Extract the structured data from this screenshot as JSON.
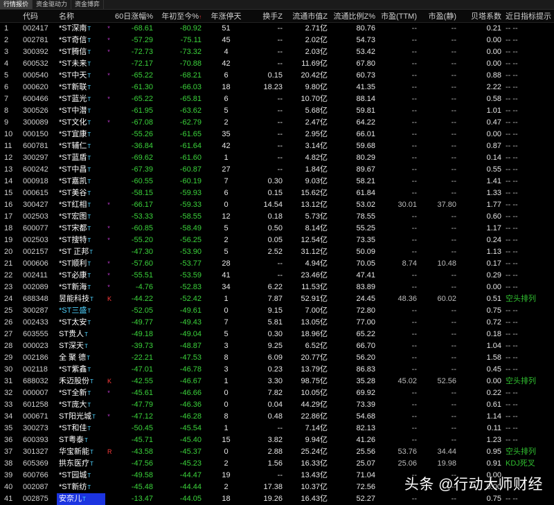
{
  "tabs": [
    "行情报价",
    "资金驱动力",
    "资金博弈"
  ],
  "headers": [
    "",
    "代码",
    "名称",
    "",
    "60日涨幅%",
    "年初至今%",
    "年涨停天",
    "换手Z",
    "流通市值Z",
    "流通比例Z%",
    "市盈(TTM)",
    "市盈(静)",
    "贝塔系数",
    "近日指标提示"
  ],
  "sort_arrow": "↑",
  "colors": {
    "negative": "#3bd43b",
    "cyan_name": "#4fd3ff",
    "selected_bg": "#1c34e0",
    "signal": "#30c030"
  },
  "rows": [
    {
      "i": "1",
      "code": "002417",
      "name": "*ST深南",
      "mk": "*",
      "d60": "-68.61",
      "ytd": "-80.92",
      "ltd": "51",
      "turn": "--",
      "mcap": "2.71亿",
      "ratio": "80.76",
      "pe_ttm": "--",
      "pe_s": "--",
      "beta": "0.21",
      "sig": "-- --"
    },
    {
      "i": "2",
      "code": "002781",
      "name": "*ST奇信",
      "mk": "*",
      "d60": "-57.29",
      "ytd": "-75.11",
      "ltd": "45",
      "turn": "--",
      "mcap": "2.02亿",
      "ratio": "54.73",
      "pe_ttm": "--",
      "pe_s": "--",
      "beta": "0.00",
      "sig": "-- --"
    },
    {
      "i": "3",
      "code": "300392",
      "name": "*ST腾信",
      "mk": "*",
      "d60": "-72.73",
      "ytd": "-73.32",
      "ltd": "4",
      "turn": "--",
      "mcap": "2.03亿",
      "ratio": "53.42",
      "pe_ttm": "--",
      "pe_s": "--",
      "beta": "0.00",
      "sig": "-- --"
    },
    {
      "i": "4",
      "code": "600532",
      "name": "*ST未来",
      "mk": "",
      "d60": "-72.17",
      "ytd": "-70.88",
      "ltd": "42",
      "turn": "--",
      "mcap": "11.69亿",
      "ratio": "67.80",
      "pe_ttm": "--",
      "pe_s": "--",
      "beta": "0.00",
      "sig": "-- --"
    },
    {
      "i": "5",
      "code": "000540",
      "name": "*ST中天",
      "mk": "*",
      "d60": "-65.22",
      "ytd": "-68.21",
      "ltd": "6",
      "turn": "0.15",
      "mcap": "20.42亿",
      "ratio": "60.73",
      "pe_ttm": "--",
      "pe_s": "--",
      "beta": "0.88",
      "sig": "-- --"
    },
    {
      "i": "6",
      "code": "000620",
      "name": "*ST新联",
      "mk": "",
      "d60": "-61.30",
      "ytd": "-66.03",
      "ltd": "18",
      "turn": "18.23",
      "mcap": "9.80亿",
      "ratio": "41.35",
      "pe_ttm": "--",
      "pe_s": "--",
      "beta": "2.22",
      "sig": "-- --"
    },
    {
      "i": "7",
      "code": "600466",
      "name": "*ST蓝光",
      "mk": "*",
      "d60": "-65.22",
      "ytd": "-65.81",
      "ltd": "6",
      "turn": "--",
      "mcap": "10.70亿",
      "ratio": "88.14",
      "pe_ttm": "--",
      "pe_s": "--",
      "beta": "0.58",
      "sig": "-- --"
    },
    {
      "i": "8",
      "code": "300526",
      "name": "*ST中潜",
      "mk": "",
      "d60": "-61.95",
      "ytd": "-63.62",
      "ltd": "5",
      "turn": "--",
      "mcap": "5.68亿",
      "ratio": "59.81",
      "pe_ttm": "--",
      "pe_s": "--",
      "beta": "1.01",
      "sig": "-- --"
    },
    {
      "i": "9",
      "code": "300089",
      "name": "*ST文化",
      "mk": "*",
      "d60": "-67.08",
      "ytd": "-62.79",
      "ltd": "2",
      "turn": "--",
      "mcap": "2.47亿",
      "ratio": "64.22",
      "pe_ttm": "--",
      "pe_s": "--",
      "beta": "0.47",
      "sig": "-- --"
    },
    {
      "i": "10",
      "code": "000150",
      "name": "*ST宜康",
      "mk": "",
      "d60": "-55.26",
      "ytd": "-61.65",
      "ltd": "35",
      "turn": "--",
      "mcap": "2.95亿",
      "ratio": "66.01",
      "pe_ttm": "--",
      "pe_s": "--",
      "beta": "0.00",
      "sig": "-- --"
    },
    {
      "i": "11",
      "code": "600781",
      "name": "*ST辅仁",
      "mk": "",
      "d60": "-36.84",
      "ytd": "-61.64",
      "ltd": "42",
      "turn": "--",
      "mcap": "3.14亿",
      "ratio": "59.68",
      "pe_ttm": "--",
      "pe_s": "--",
      "beta": "0.87",
      "sig": "-- --"
    },
    {
      "i": "12",
      "code": "300297",
      "name": "*ST蓝盾",
      "mk": "",
      "d60": "-69.62",
      "ytd": "-61.60",
      "ltd": "1",
      "turn": "--",
      "mcap": "4.82亿",
      "ratio": "80.29",
      "pe_ttm": "--",
      "pe_s": "--",
      "beta": "0.14",
      "sig": "-- --"
    },
    {
      "i": "13",
      "code": "600242",
      "name": "*ST中昌",
      "mk": "",
      "d60": "-67.39",
      "ytd": "-60.87",
      "ltd": "27",
      "turn": "--",
      "mcap": "1.84亿",
      "ratio": "89.67",
      "pe_ttm": "--",
      "pe_s": "--",
      "beta": "0.55",
      "sig": "-- --"
    },
    {
      "i": "14",
      "code": "000918",
      "name": "*ST嘉凯",
      "mk": "",
      "d60": "-60.55",
      "ytd": "-60.19",
      "ltd": "7",
      "turn": "0.30",
      "mcap": "9.03亿",
      "ratio": "58.21",
      "pe_ttm": "--",
      "pe_s": "--",
      "beta": "1.41",
      "sig": "-- --"
    },
    {
      "i": "15",
      "code": "000615",
      "name": "*ST美谷",
      "mk": "",
      "d60": "-58.15",
      "ytd": "-59.93",
      "ltd": "6",
      "turn": "0.15",
      "mcap": "15.62亿",
      "ratio": "61.84",
      "pe_ttm": "--",
      "pe_s": "--",
      "beta": "1.33",
      "sig": "-- --"
    },
    {
      "i": "16",
      "code": "300427",
      "name": "*ST红相",
      "mk": "*",
      "d60": "-66.17",
      "ytd": "-59.33",
      "ltd": "0",
      "turn": "14.54",
      "mcap": "13.12亿",
      "ratio": "53.02",
      "pe_ttm": "30.01",
      "pe_s": "37.80",
      "beta": "1.77",
      "sig": "-- --"
    },
    {
      "i": "17",
      "code": "002503",
      "name": "*ST宏图",
      "mk": "",
      "d60": "-53.33",
      "ytd": "-58.55",
      "ltd": "12",
      "turn": "0.18",
      "mcap": "5.73亿",
      "ratio": "78.55",
      "pe_ttm": "--",
      "pe_s": "--",
      "beta": "0.60",
      "sig": "-- --"
    },
    {
      "i": "18",
      "code": "600077",
      "name": "*ST宋都",
      "mk": "*",
      "d60": "-60.85",
      "ytd": "-58.49",
      "ltd": "5",
      "turn": "0.50",
      "mcap": "8.14亿",
      "ratio": "55.25",
      "pe_ttm": "--",
      "pe_s": "--",
      "beta": "1.17",
      "sig": "-- --"
    },
    {
      "i": "19",
      "code": "002503",
      "name": "*ST搜特",
      "mk": "*",
      "d60": "-55.20",
      "ytd": "-56.25",
      "ltd": "2",
      "turn": "0.05",
      "mcap": "12.54亿",
      "ratio": "73.35",
      "pe_ttm": "--",
      "pe_s": "--",
      "beta": "0.24",
      "sig": "-- --"
    },
    {
      "i": "20",
      "code": "002157",
      "name": "*ST 正邦",
      "mk": "",
      "d60": "-47.30",
      "ytd": "-53.90",
      "ltd": "5",
      "turn": "2.52",
      "mcap": "31.12亿",
      "ratio": "50.09",
      "pe_ttm": "--",
      "pe_s": "--",
      "beta": "1.13",
      "sig": "-- --"
    },
    {
      "i": "21",
      "code": "000606",
      "name": "*ST顺利",
      "mk": "*",
      "d60": "-57.60",
      "ytd": "-53.77",
      "ltd": "28",
      "turn": "--",
      "mcap": "4.94亿",
      "ratio": "70.05",
      "pe_ttm": "8.74",
      "pe_s": "10.48",
      "beta": "0.17",
      "sig": "-- --"
    },
    {
      "i": "22",
      "code": "002411",
      "name": "*ST必康",
      "mk": "*",
      "d60": "-55.51",
      "ytd": "-53.59",
      "ltd": "41",
      "turn": "--",
      "mcap": "23.46亿",
      "ratio": "47.41",
      "pe_ttm": "--",
      "pe_s": "--",
      "beta": "0.29",
      "sig": "-- --"
    },
    {
      "i": "23",
      "code": "002089",
      "name": "*ST新海",
      "mk": "*",
      "d60": "-4.76",
      "ytd": "-52.83",
      "ltd": "34",
      "turn": "6.22",
      "mcap": "11.53亿",
      "ratio": "83.89",
      "pe_ttm": "--",
      "pe_s": "--",
      "beta": "0.00",
      "sig": "-- --"
    },
    {
      "i": "24",
      "code": "688348",
      "name": "昱能科技",
      "mk": "K",
      "d60": "-44.22",
      "ytd": "-52.42",
      "ltd": "1",
      "turn": "7.87",
      "mcap": "52.91亿",
      "ratio": "24.45",
      "pe_ttm": "48.36",
      "pe_s": "60.02",
      "beta": "0.51",
      "sig": "空头排列"
    },
    {
      "i": "25",
      "code": "300287",
      "name": "*ST三盛",
      "mk": "",
      "d60": "-52.05",
      "ytd": "-49.61",
      "ltd": "0",
      "turn": "9.15",
      "mcap": "7.00亿",
      "ratio": "72.80",
      "pe_ttm": "--",
      "pe_s": "--",
      "beta": "0.75",
      "sig": "-- --"
    },
    {
      "i": "26",
      "code": "002433",
      "name": "*ST太安",
      "mk": "",
      "d60": "-49.77",
      "ytd": "-49.43",
      "ltd": "7",
      "turn": "5.81",
      "mcap": "13.05亿",
      "ratio": "77.00",
      "pe_ttm": "--",
      "pe_s": "--",
      "beta": "0.72",
      "sig": "-- --"
    },
    {
      "i": "27",
      "code": "603555",
      "name": "ST贵人",
      "mk": "",
      "d60": "-49.18",
      "ytd": "-49.04",
      "ltd": "5",
      "turn": "0.30",
      "mcap": "18.96亿",
      "ratio": "65.22",
      "pe_ttm": "--",
      "pe_s": "--",
      "beta": "0.18",
      "sig": "-- --"
    },
    {
      "i": "28",
      "code": "000023",
      "name": "ST深天",
      "mk": "",
      "d60": "-39.73",
      "ytd": "-48.87",
      "ltd": "3",
      "turn": "9.25",
      "mcap": "6.52亿",
      "ratio": "66.70",
      "pe_ttm": "--",
      "pe_s": "--",
      "beta": "1.04",
      "sig": "-- --"
    },
    {
      "i": "29",
      "code": "002186",
      "name": "全 聚 德",
      "mk": "",
      "d60": "-22.21",
      "ytd": "-47.53",
      "ltd": "8",
      "turn": "6.09",
      "mcap": "20.77亿",
      "ratio": "56.20",
      "pe_ttm": "--",
      "pe_s": "--",
      "beta": "1.58",
      "sig": "-- --"
    },
    {
      "i": "30",
      "code": "002118",
      "name": "*ST紫鑫",
      "mk": "",
      "d60": "-47.01",
      "ytd": "-46.78",
      "ltd": "3",
      "turn": "0.23",
      "mcap": "13.79亿",
      "ratio": "86.83",
      "pe_ttm": "--",
      "pe_s": "--",
      "beta": "0.45",
      "sig": "-- --"
    },
    {
      "i": "31",
      "code": "688032",
      "name": "禾迈股份",
      "mk": "K",
      "d60": "-42.55",
      "ytd": "-46.67",
      "ltd": "1",
      "turn": "3.30",
      "mcap": "98.75亿",
      "ratio": "35.28",
      "pe_ttm": "45.02",
      "pe_s": "52.56",
      "beta": "0.00",
      "sig": "空头排列"
    },
    {
      "i": "32",
      "code": "000007",
      "name": "*ST全新",
      "mk": "*",
      "d60": "-45.61",
      "ytd": "-46.66",
      "ltd": "0",
      "turn": "7.82",
      "mcap": "10.05亿",
      "ratio": "69.92",
      "pe_ttm": "--",
      "pe_s": "--",
      "beta": "0.22",
      "sig": "-- --"
    },
    {
      "i": "33",
      "code": "601258",
      "name": "*ST庞大",
      "mk": "",
      "d60": "-47.79",
      "ytd": "-46.36",
      "ltd": "0",
      "turn": "0.04",
      "mcap": "44.29亿",
      "ratio": "73.39",
      "pe_ttm": "--",
      "pe_s": "--",
      "beta": "0.61",
      "sig": "-- --"
    },
    {
      "i": "34",
      "code": "000671",
      "name": "ST阳光城",
      "mk": "*",
      "d60": "-47.12",
      "ytd": "-46.28",
      "ltd": "8",
      "turn": "0.48",
      "mcap": "22.86亿",
      "ratio": "54.68",
      "pe_ttm": "--",
      "pe_s": "--",
      "beta": "1.14",
      "sig": "-- --"
    },
    {
      "i": "35",
      "code": "300273",
      "name": "*ST和佳",
      "mk": "",
      "d60": "-50.45",
      "ytd": "-45.54",
      "ltd": "1",
      "turn": "--",
      "mcap": "7.14亿",
      "ratio": "82.13",
      "pe_ttm": "--",
      "pe_s": "--",
      "beta": "0.11",
      "sig": "-- --"
    },
    {
      "i": "36",
      "code": "600393",
      "name": "ST粤泰",
      "mk": "",
      "d60": "-45.71",
      "ytd": "-45.40",
      "ltd": "15",
      "turn": "3.82",
      "mcap": "9.94亿",
      "ratio": "41.26",
      "pe_ttm": "--",
      "pe_s": "--",
      "beta": "1.23",
      "sig": "-- --"
    },
    {
      "i": "37",
      "code": "301327",
      "name": "华宝新能",
      "mk": "R",
      "d60": "-43.58",
      "ytd": "-45.37",
      "ltd": "0",
      "turn": "2.88",
      "mcap": "25.24亿",
      "ratio": "25.56",
      "pe_ttm": "53.76",
      "pe_s": "34.44",
      "beta": "0.95",
      "sig": "空头排列"
    },
    {
      "i": "38",
      "code": "605369",
      "name": "拱东医疗",
      "mk": "",
      "d60": "-47.56",
      "ytd": "-45.23",
      "ltd": "2",
      "turn": "1.56",
      "mcap": "16.33亿",
      "ratio": "25.07",
      "pe_ttm": "25.06",
      "pe_s": "19.98",
      "beta": "0.91",
      "sig": "KDJ死叉"
    },
    {
      "i": "39",
      "code": "600766",
      "name": "*ST园城",
      "mk": "",
      "d60": "-49.58",
      "ytd": "-44.47",
      "ltd": "19",
      "turn": "--",
      "mcap": "13.43亿",
      "ratio": "71.04",
      "pe_ttm": "--",
      "pe_s": "--",
      "beta": "0.00",
      "sig": ""
    },
    {
      "i": "40",
      "code": "002087",
      "name": "*ST新纺",
      "mk": "",
      "d60": "-45.48",
      "ytd": "-44.44",
      "ltd": "2",
      "turn": "17.38",
      "mcap": "10.37亿",
      "ratio": "72.56",
      "pe_ttm": "--",
      "pe_s": "--",
      "beta": "0.00",
      "sig": ""
    },
    {
      "i": "41",
      "code": "002875",
      "name": "安奈儿",
      "mk": "",
      "d60": "-13.47",
      "ytd": "-44.05",
      "ltd": "18",
      "turn": "19.26",
      "mcap": "16.43亿",
      "ratio": "52.27",
      "pe_ttm": "--",
      "pe_s": "--",
      "beta": "0.75",
      "sig": "-- --"
    }
  ],
  "cyan_rows": [
    "25"
  ],
  "selected_row": "41",
  "watermark": "头条 @行动大师财经"
}
